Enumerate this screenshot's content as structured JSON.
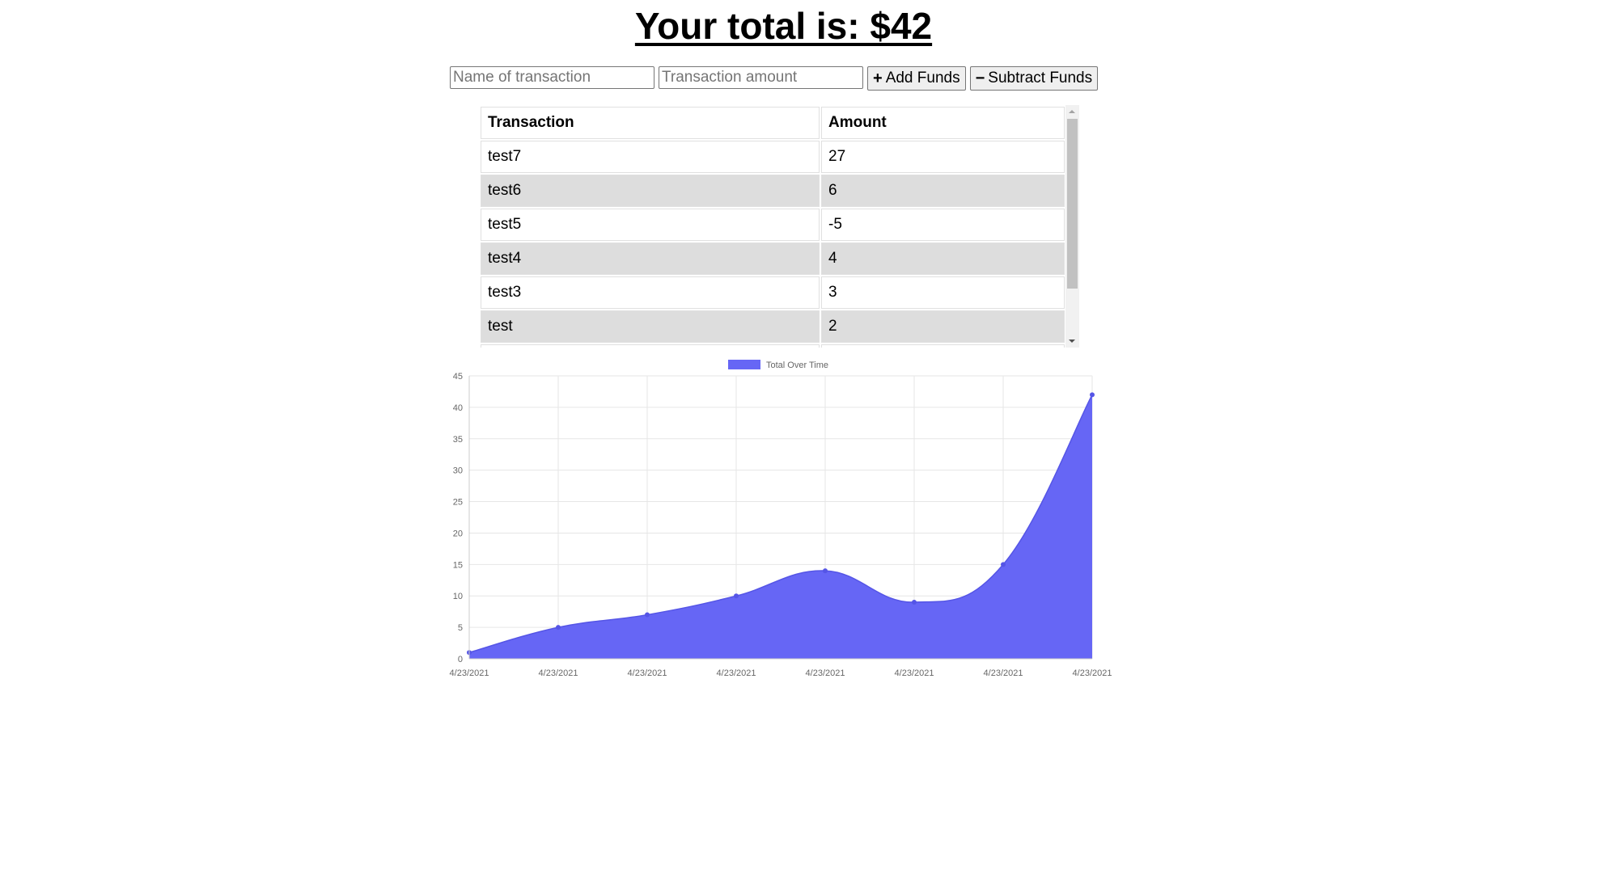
{
  "header": {
    "total_text": "Your total is: $42"
  },
  "form": {
    "name_placeholder": "Name of transaction",
    "amount_placeholder": "Transaction amount",
    "add_label": "Add Funds",
    "subtract_label": "Subtract Funds",
    "add_icon": "plus-icon",
    "subtract_icon": "minus-icon"
  },
  "table": {
    "headers": [
      "Transaction",
      "Amount"
    ],
    "rows": [
      {
        "name": "test7",
        "amount": "27"
      },
      {
        "name": "test6",
        "amount": "6"
      },
      {
        "name": "test5",
        "amount": "-5"
      },
      {
        "name": "test4",
        "amount": "4"
      },
      {
        "name": "test3",
        "amount": "3"
      },
      {
        "name": "test",
        "amount": "2"
      }
    ]
  },
  "colors": {
    "fill": "#6666f5",
    "point": "#5555e6",
    "grid": "#e6e6e6",
    "row_shade": "#dddddd"
  },
  "chart_data": {
    "type": "area",
    "title": "",
    "legend": "top-center",
    "grid": true,
    "x": [
      "4/23/2021",
      "4/23/2021",
      "4/23/2021",
      "4/23/2021",
      "4/23/2021",
      "4/23/2021",
      "4/23/2021",
      "4/23/2021"
    ],
    "series": [
      {
        "name": "Total Over Time",
        "values": [
          1,
          5,
          7,
          10,
          14,
          9,
          15,
          42
        ]
      }
    ],
    "ylim": [
      0,
      45
    ],
    "yticks": [
      0,
      5,
      10,
      15,
      20,
      25,
      30,
      35,
      40,
      45
    ]
  }
}
